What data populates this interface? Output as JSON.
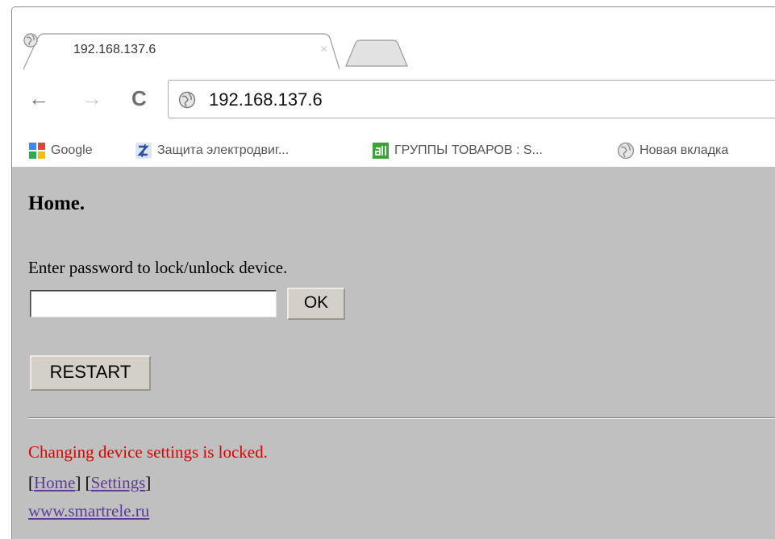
{
  "tab": {
    "title": "192.168.137.6",
    "close_label": "×"
  },
  "toolbar": {
    "back_glyph": "←",
    "forward_glyph": "→",
    "reload_glyph": "C",
    "url": "192.168.137.6"
  },
  "bookmarks": [
    {
      "label": "Google",
      "icon": "google-icon"
    },
    {
      "label": "Защита электродвиг...",
      "icon": "bookmark-z-icon"
    },
    {
      "label": "ГРУППЫ ТОВАРОВ : S...",
      "icon": "green-app-icon"
    },
    {
      "label": "Новая вкладка",
      "icon": "globe-icon"
    }
  ],
  "page": {
    "heading": "Home.",
    "prompt": "Enter password to lock/unlock device.",
    "password_value": "",
    "ok_label": "OK",
    "restart_label": "RESTART",
    "status": "Changing device settings is locked.",
    "nav": {
      "open1": "[",
      "home_label": "Home",
      "close1": "]",
      "sep": " ",
      "open2": "[",
      "settings_label": "Settings",
      "close2": "]"
    },
    "site_link": "www.smartrele.ru"
  },
  "colors": {
    "content_bg": "#c0c0c0",
    "status_text": "#e00000",
    "link": "#5a3c96"
  }
}
